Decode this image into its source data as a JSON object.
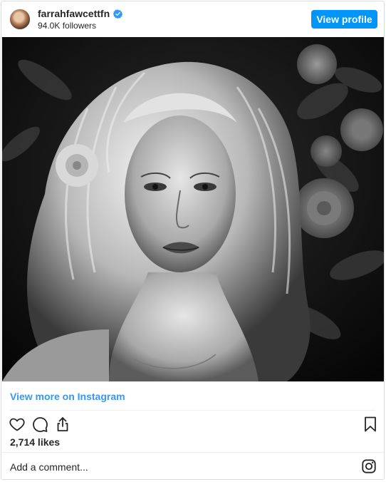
{
  "header": {
    "username": "farrahfawcettfn",
    "followers": "94.0K followers",
    "view_profile_label": "View profile",
    "verified_color": "#3897f0",
    "avatar_icon": "profile-avatar"
  },
  "post": {
    "image_alt": "Black and white portrait photo",
    "view_more_label": "View more on Instagram",
    "likes": "2,714 likes",
    "icons": [
      "heart-icon",
      "comment-icon",
      "share-icon",
      "bookmark-icon"
    ]
  },
  "comment": {
    "placeholder": "Add a comment...",
    "instagram_icon": "instagram-logo-icon"
  },
  "colors": {
    "accent": "#0095f6",
    "link": "#3897f0",
    "text": "#262626",
    "border": "#dbdbdb"
  }
}
